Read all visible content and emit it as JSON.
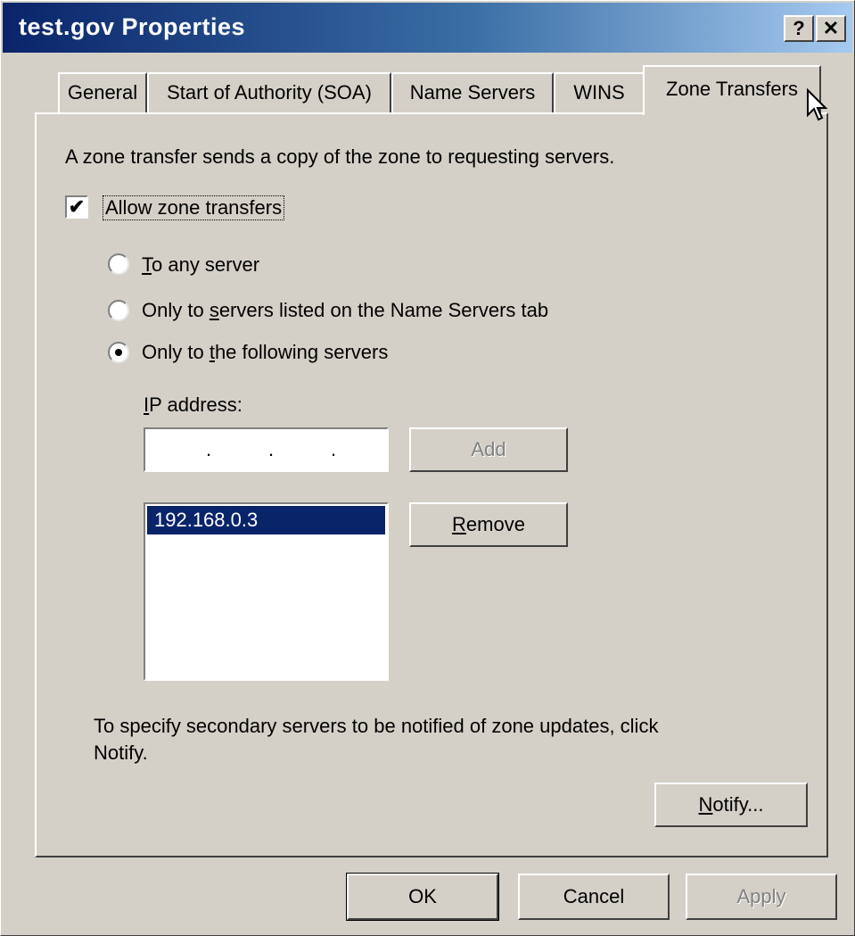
{
  "window": {
    "title": "test.gov Properties",
    "help_glyph": "?",
    "close_glyph": "✕"
  },
  "tabs": [
    {
      "label": "General"
    },
    {
      "label": "Start of Authority (SOA)"
    },
    {
      "label": "Name Servers"
    },
    {
      "label": "WINS"
    },
    {
      "label": "Zone Transfers",
      "active": true
    }
  ],
  "zone_transfers": {
    "intro": "A zone transfer sends a copy of the zone to requesting servers.",
    "allow_checkbox": {
      "label": "Allow zone transfers",
      "checked": true,
      "check_glyph": "✔"
    },
    "radios": [
      {
        "label_u": "T",
        "label_rest": "o any server",
        "selected": false
      },
      {
        "label_pre": "Only to ",
        "label_u": "s",
        "label_rest": "ervers listed on the Name Servers tab",
        "selected": false
      },
      {
        "label_pre": "Only to ",
        "label_u": "t",
        "label_rest": "he following servers",
        "selected": true
      }
    ],
    "ip_label_u": "I",
    "ip_label_rest": "P address:",
    "ip_value": "   .   .   .",
    "ip_dots": [
      ".",
      ".",
      "."
    ],
    "add_button": "Add",
    "remove_button_u": "R",
    "remove_button_rest": "emove",
    "server_list": [
      "192.168.0.3"
    ],
    "notify_text_line1": "To specify secondary servers to be notified of zone updates, click",
    "notify_text_line2": "Notify.",
    "notify_button_u": "N",
    "notify_button_rest": "otify..."
  },
  "footer": {
    "ok": "OK",
    "cancel": "Cancel",
    "apply": "Apply"
  },
  "colors": {
    "face": "#d4d0c8",
    "title_start": "#0a246a",
    "title_end": "#a6caf0",
    "selection": "#0a246a"
  }
}
